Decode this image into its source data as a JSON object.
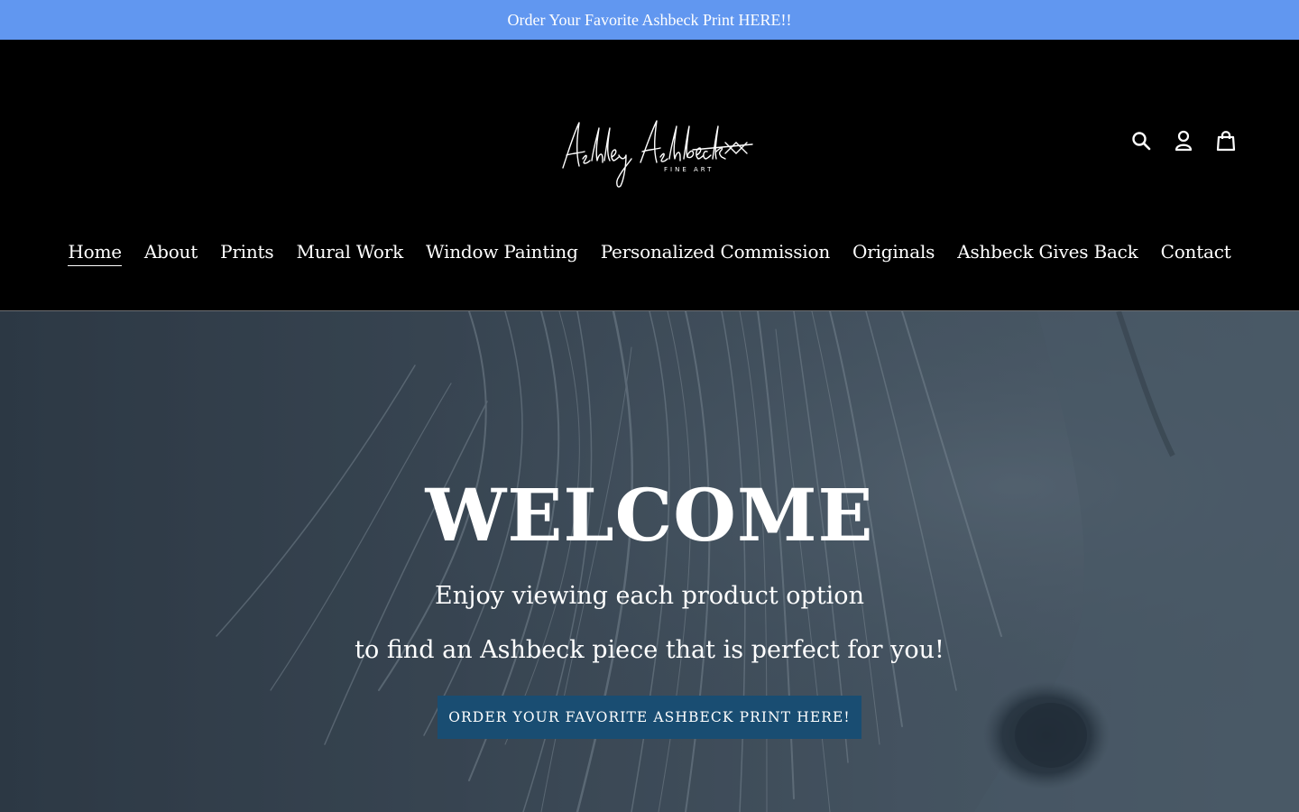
{
  "announcement": {
    "text": "Order Your Favorite Ashbeck Print HERE!!"
  },
  "logo": {
    "script_text": "Ashley Ashbeck",
    "subtitle": "FINE ART"
  },
  "header_icons": [
    "search-icon",
    "account-icon",
    "cart-icon"
  ],
  "nav": {
    "items": [
      {
        "label": "Home",
        "active": true
      },
      {
        "label": "About"
      },
      {
        "label": "Prints"
      },
      {
        "label": "Mural Work"
      },
      {
        "label": "Window Painting"
      },
      {
        "label": "Personalized Commission"
      },
      {
        "label": "Originals"
      },
      {
        "label": "Ashbeck Gives Back"
      },
      {
        "label": "Contact"
      }
    ]
  },
  "hero": {
    "title": "WELCOME",
    "line1": "Enjoy viewing each product option",
    "line2": "to find an Ashbeck piece that is perfect for you!",
    "button_label": "ORDER YOUR FAVORITE ASHBECK PRINT HERE!"
  },
  "colors": {
    "announcement_bg": "#6197f0",
    "header_bg": "#000000",
    "hero_bg": "#3a4752",
    "button_bg": "#194d72"
  }
}
